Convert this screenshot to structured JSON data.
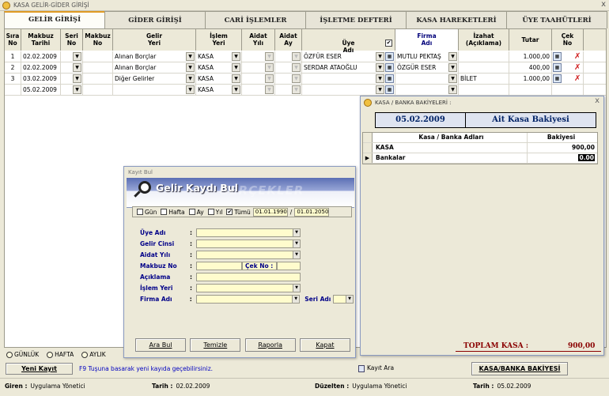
{
  "window": {
    "title": "KASA GELİR-GİDER GİRİŞİ",
    "close": "x"
  },
  "tabs": [
    "GELİR GİRİŞİ",
    "GİDER GİRİŞİ",
    "CARİ İŞLEMLER",
    "İŞLETME DEFTERİ",
    "KASA HAREKETLERİ",
    "ÜYE TAAHÜTLERİ"
  ],
  "grid": {
    "headers": [
      "Sıra\nNo",
      "Makbuz\nTarihi",
      "Seri\nNo",
      "Makbuz\nNo",
      "Gelir\nYeri",
      "İşlem\nYeri",
      "Aidat\nYılı",
      "Aidat\nAy",
      "Üye\nAdı",
      "Firma\nAdı",
      "İzahat\n(Açıklama)",
      "Tutar",
      "Çek\nNo"
    ],
    "uye_checkbox": "✔",
    "rows": [
      {
        "sira": "1",
        "tarih": "02.02.2009",
        "gelir": "Alınan Borçlar",
        "islem": "KASA",
        "uye": "ÖZFÜR ESER",
        "firma": "MUTLU PEKTAŞ",
        "izahat": "",
        "tutar": "1.000,00"
      },
      {
        "sira": "2",
        "tarih": "02.02.2009",
        "gelir": "Alınan Borçlar",
        "islem": "KASA",
        "uye": "SERDAR ATAOĞLU",
        "firma": "ÖZGÜR ESER",
        "izahat": "",
        "tutar": "400,00"
      },
      {
        "sira": "3",
        "tarih": "03.02.2009",
        "gelir": "Diğer Gelirler",
        "islem": "KASA",
        "uye": "",
        "firma": "",
        "izahat": "BİLET",
        "tutar": "1.000,00"
      },
      {
        "sira": "",
        "tarih": "05.02.2009",
        "gelir": "",
        "islem": "KASA",
        "uye": "",
        "firma": "",
        "izahat": "",
        "tutar": ""
      }
    ]
  },
  "search": {
    "window_title": "Kayıt Bul",
    "heading": "Gelir Kaydı Bul",
    "watermark": "GERÇEKLER",
    "periods": [
      {
        "label": "Gün",
        "checked": false
      },
      {
        "label": "Hafta",
        "checked": false
      },
      {
        "label": "Ay",
        "checked": false
      },
      {
        "label": "Yıl",
        "checked": false
      },
      {
        "label": "Tümü",
        "checked": true
      }
    ],
    "date_from": "01.01.1990",
    "date_sep": "/",
    "date_to": "01.01.2050",
    "fields": {
      "uye": "Üye Adı",
      "gelir_cinsi": "Gelir Cinsi",
      "aidat_yili": "Aidat Yılı",
      "makbuz_no": "Makbuz No",
      "cek_no": "Çek No :",
      "aciklama": "Açıklama",
      "islem_yeri": "İşlem Yeri",
      "firma": "Firma Adı",
      "seri": "Seri Adı",
      "colon": ":"
    },
    "buttons": [
      "Ara Bul",
      "Temizle",
      "Raporla",
      "Kapat"
    ]
  },
  "bank": {
    "title": "KASA / BANKA BAKİYELERİ :",
    "close": "x",
    "date": "05.02.2009",
    "heading": "Ait Kasa Bakiyesi",
    "col_name": "Kasa / Banka Adları",
    "col_value": "Bakiyesi",
    "rows": [
      {
        "name": "KASA",
        "value": "900,00"
      },
      {
        "name": "Bankalar",
        "value": "0.00"
      }
    ],
    "total_label": "TOPLAM KASA :",
    "total_value": "900,00"
  },
  "view_tabs": [
    "GÜNLÜK",
    "HAFTA",
    "AYLIK"
  ],
  "buttons": {
    "new": "Yeni Kayıt",
    "bank_balance": "KASA/BANKA BAKİYESİ",
    "kasa_ara": "Kayıt Ara"
  },
  "hint": "F9 Tuşuna basarak yeni kayıda geçebilirsiniz.",
  "status": {
    "giren_label": "Giren :",
    "giren": "Uygulama Yönetici",
    "tarih_label": "Tarih :",
    "tarih": "02.02.2009",
    "duzelten_label": "Düzelten :",
    "duzelten": "Uygulama Yönetici",
    "tarih2_label": "Tarih :",
    "tarih2": "05.02.2009"
  }
}
